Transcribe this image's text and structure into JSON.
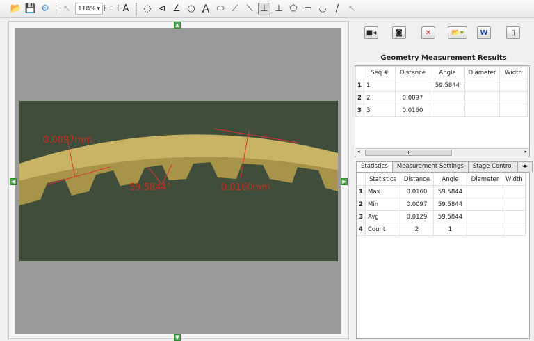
{
  "toolbar": {
    "zoom": "118%"
  },
  "image_labels": {
    "dist1": "0.0097mm",
    "angle": "59.5844°",
    "dist2": "0.0160mm"
  },
  "results": {
    "title": "Geometry Measurement Results",
    "columns": [
      "Seq #",
      "Distance",
      "Angle",
      "Diameter",
      "Width"
    ],
    "rows": [
      {
        "n": "1",
        "seq": "1",
        "distance": "",
        "angle": "59.5844"
      },
      {
        "n": "2",
        "seq": "2",
        "distance": "0.0097",
        "angle": ""
      },
      {
        "n": "3",
        "seq": "3",
        "distance": "0.0160",
        "angle": ""
      }
    ],
    "scroll_thumb": "III"
  },
  "tabs": [
    "Statistics",
    "Measurement Settings",
    "Stage Control"
  ],
  "statistics": {
    "columns": [
      "Statistics",
      "Distance",
      "Angle",
      "Diameter",
      "Width"
    ],
    "rows": [
      {
        "n": "1",
        "name": "Max",
        "distance": "0.0160",
        "angle": "59.5844"
      },
      {
        "n": "2",
        "name": "Min",
        "distance": "0.0097",
        "angle": "59.5844"
      },
      {
        "n": "3",
        "name": "Avg",
        "distance": "0.0129",
        "angle": "59.5844"
      },
      {
        "n": "4",
        "name": "Count",
        "distance": "2",
        "angle": "1"
      }
    ]
  }
}
